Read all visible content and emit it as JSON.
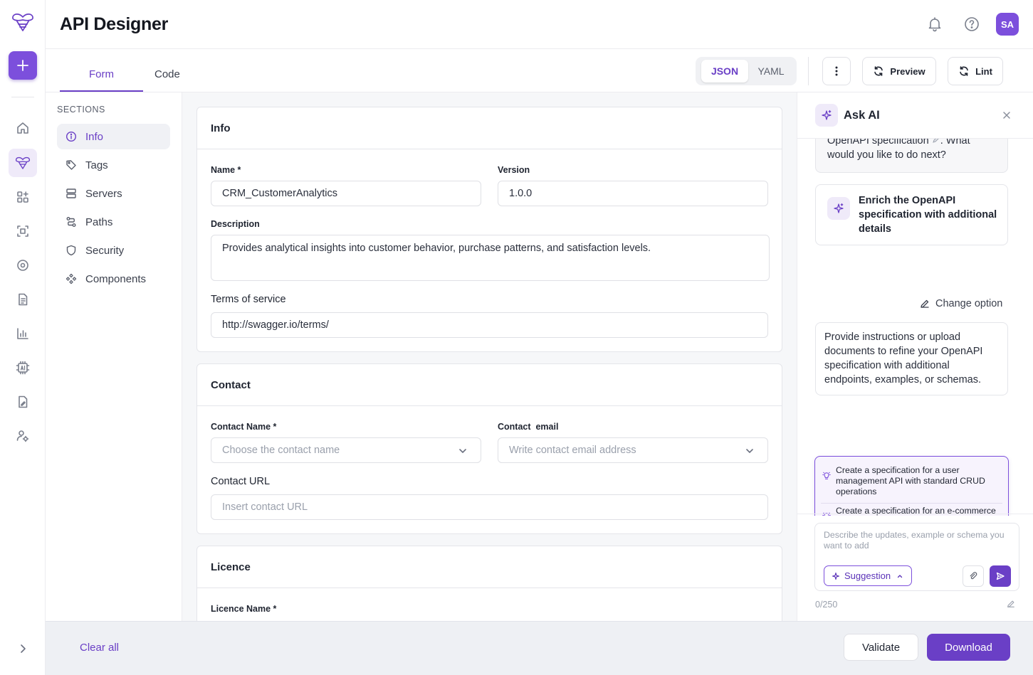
{
  "app": {
    "title": "API Designer",
    "avatar_initials": "SA",
    "accent_color": "#6a3fc6"
  },
  "rail": {
    "items": [
      {
        "name": "home-icon",
        "active": false
      },
      {
        "name": "api-designer-icon",
        "active": true
      },
      {
        "name": "apps-grid-icon",
        "active": false
      },
      {
        "name": "focus-frame-icon",
        "active": false
      },
      {
        "name": "radar-icon",
        "active": false
      },
      {
        "name": "document-icon",
        "active": false
      },
      {
        "name": "bar-chart-icon",
        "active": false
      },
      {
        "name": "ai-chip-icon",
        "active": false
      },
      {
        "name": "edit-document-icon",
        "active": false
      },
      {
        "name": "users-settings-icon",
        "active": false
      }
    ]
  },
  "tabs": {
    "form": "Form",
    "code": "Code",
    "active": "Form"
  },
  "toolbar": {
    "json": "JSON",
    "yaml": "YAML",
    "selected_format": "JSON",
    "preview": "Preview",
    "lint": "Lint"
  },
  "sections": {
    "caption": "SECTIONS",
    "items": [
      {
        "label": "Info",
        "icon": "info-icon"
      },
      {
        "label": "Tags",
        "icon": "tag-icon"
      },
      {
        "label": "Servers",
        "icon": "server-icon"
      },
      {
        "label": "Paths",
        "icon": "paths-icon"
      },
      {
        "label": "Security",
        "icon": "shield-icon"
      },
      {
        "label": "Components",
        "icon": "components-icon"
      }
    ],
    "active": "Info"
  },
  "info": {
    "title": "Info",
    "name_label": "Name *",
    "name_value": "CRM_CustomerAnalytics",
    "version_label": "Version",
    "version_value": "1.0.0",
    "description_label": "Description",
    "description_value": "Provides analytical insights into customer behavior, purchase patterns, and satisfaction levels.",
    "terms_label": "Terms of service",
    "terms_value": "http://swagger.io/terms/"
  },
  "contact": {
    "title": "Contact",
    "name_label": "Contact Name *",
    "name_placeholder": "Choose the contact name",
    "email_label": "Contact  email",
    "email_placeholder": "Write contact email address",
    "url_label": "Contact URL",
    "url_placeholder": "Insert contact URL"
  },
  "licence": {
    "title": "Licence",
    "name_label": "Licence Name *"
  },
  "ask_ai": {
    "title": "Ask AI",
    "message_fragment_line1": "OpenAPI specification",
    "message_fragment_line1_tail": ". What",
    "message_fragment_line2": "would you like to do next?",
    "option_text": "Enrich the OpenAPI specification with additional details",
    "change_option": "Change option",
    "instructions": "Provide instructions or upload documents to refine your OpenAPI specification with additional endpoints, examples, or schemas.",
    "suggestions": [
      "Create a specification for a user management API with standard CRUD operations",
      "Create a specification for an e-commerce API including products, orders, and payment processing"
    ],
    "input_placeholder": "Describe the updates, example or schema you want to add",
    "suggestion_button": "Suggestion",
    "counter": "0/250"
  },
  "footer": {
    "clear_all": "Clear all",
    "validate": "Validate",
    "download": "Download"
  }
}
